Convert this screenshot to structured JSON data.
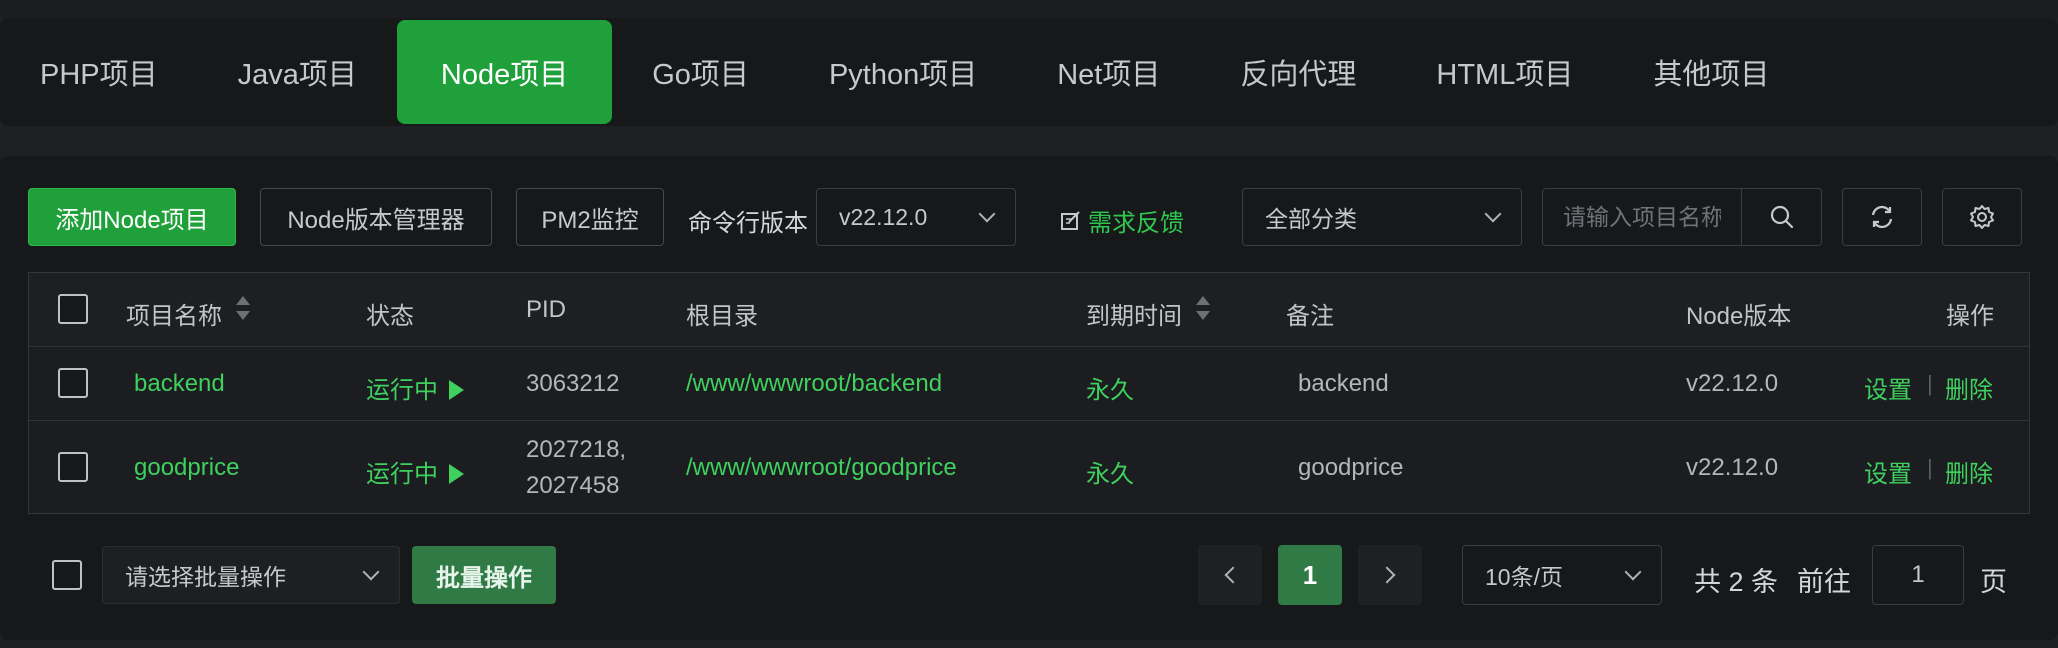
{
  "tabs": [
    {
      "label": "PHP项目",
      "active": false
    },
    {
      "label": "Java项目",
      "active": false
    },
    {
      "label": "Node项目",
      "active": true
    },
    {
      "label": "Go项目",
      "active": false
    },
    {
      "label": "Python项目",
      "active": false
    },
    {
      "label": "Net项目",
      "active": false
    },
    {
      "label": "反向代理",
      "active": false
    },
    {
      "label": "HTML项目",
      "active": false
    },
    {
      "label": "其他项目",
      "active": false
    }
  ],
  "toolbar": {
    "add_label": "添加Node项目",
    "version_manager_label": "Node版本管理器",
    "pm2_label": "PM2监控",
    "cli_version_label": "命令行版本",
    "cli_version_value": "v22.12.0",
    "feedback_label": "需求反馈",
    "category_value": "全部分类",
    "search_placeholder": "请输入项目名称"
  },
  "table": {
    "headers": {
      "name": "项目名称",
      "status": "状态",
      "pid": "PID",
      "root": "根目录",
      "expire": "到期时间",
      "remark": "备注",
      "node_version": "Node版本",
      "actions": "操作"
    },
    "rows": [
      {
        "name": "backend",
        "status": "运行中",
        "pid_line1": "3063212",
        "pid_line2": "",
        "root": "/www/wwwroot/backend",
        "expire": "永久",
        "remark": "backend",
        "node_version": "v22.12.0",
        "settings": "设置",
        "delete": "删除"
      },
      {
        "name": "goodprice",
        "status": "运行中",
        "pid_line1": "2027218,",
        "pid_line2": "2027458",
        "root": "/www/wwwroot/goodprice",
        "expire": "永久",
        "remark": "goodprice",
        "node_version": "v22.12.0",
        "settings": "设置",
        "delete": "删除"
      }
    ],
    "action_separator": "|"
  },
  "footer": {
    "batch_placeholder": "请选择批量操作",
    "batch_button": "批量操作",
    "current_page": "1",
    "page_size": "10条/页",
    "total_text": "共 2 条",
    "goto_label": "前往",
    "goto_value": "1",
    "page_unit": "页"
  },
  "colors": {
    "accent": "#20a03a",
    "running": "#3fd05e",
    "background": "#17181a"
  }
}
